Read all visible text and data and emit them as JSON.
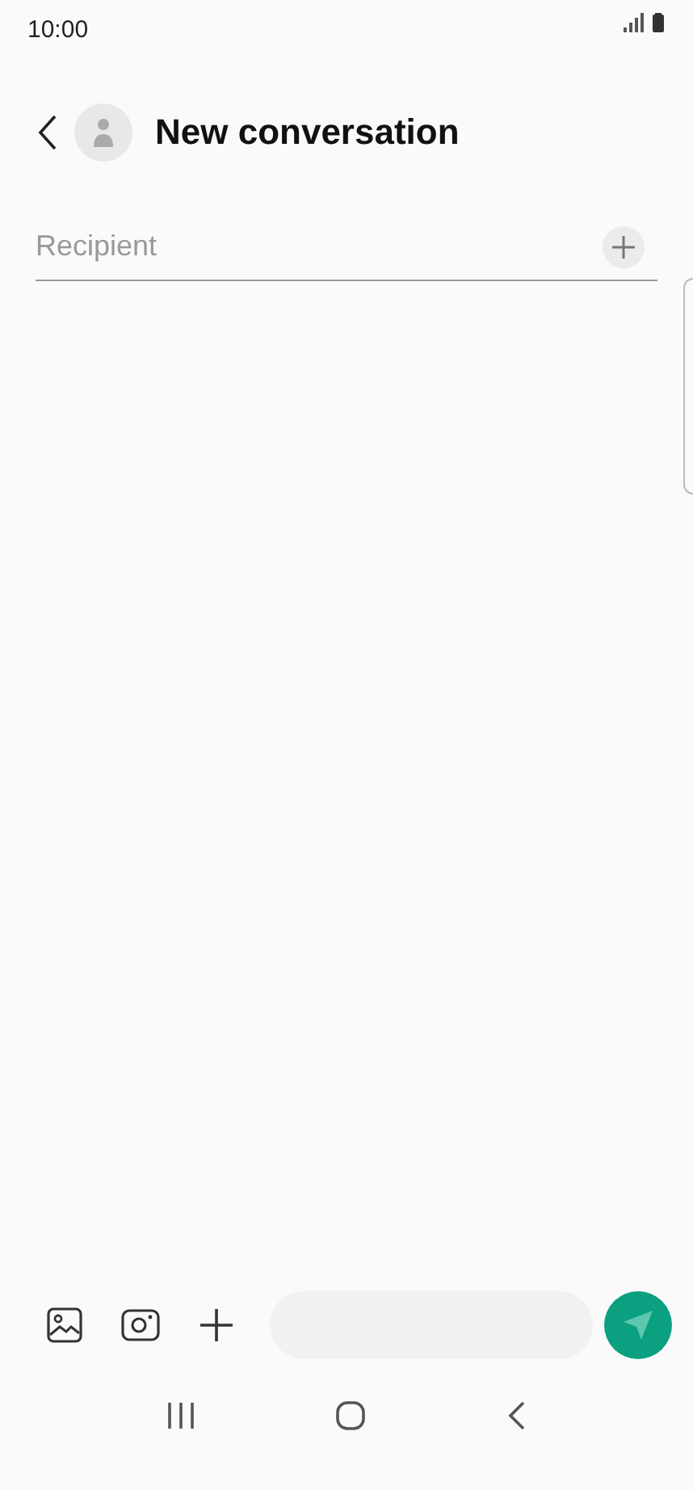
{
  "status_bar": {
    "time": "10:00"
  },
  "header": {
    "title": "New conversation"
  },
  "recipient": {
    "placeholder": "Recipient"
  }
}
